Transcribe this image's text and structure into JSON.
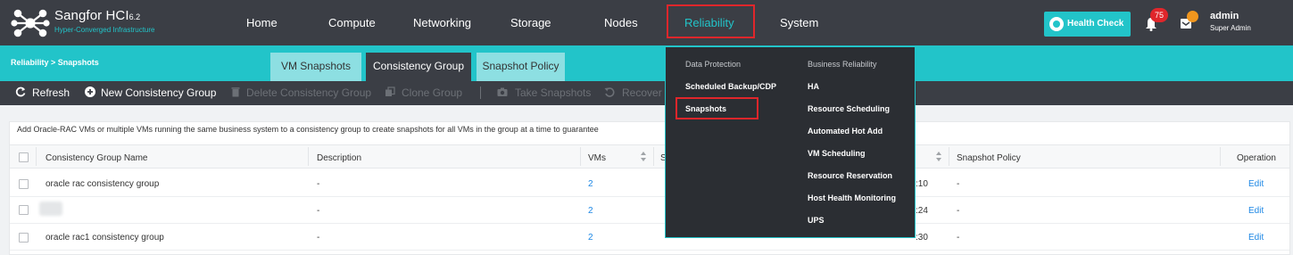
{
  "brand": {
    "name": "Sangfor HCI",
    "version": "6.2",
    "subtitle": "Hyper-Converged Infrastructure"
  },
  "nav": {
    "items": [
      "Home",
      "Compute",
      "Networking",
      "Storage",
      "Nodes",
      "Reliability",
      "System"
    ],
    "active": "Reliability"
  },
  "header": {
    "health_check": "Health Check",
    "alert_count": "75",
    "username": "admin",
    "role": "Super Admin"
  },
  "breadcrumb": "Reliability > Snapshots",
  "tabs": [
    "VM Snapshots",
    "Consistency Group",
    "Snapshot Policy"
  ],
  "active_tab": "Consistency Group",
  "toolbar": {
    "refresh": "Refresh",
    "new_group": "New Consistency Group",
    "delete_group": "Delete Consistency Group",
    "clone_group": "Clone Group",
    "take_snapshots": "Take Snapshots",
    "recover": "Recover"
  },
  "info_text": "Add Oracle-RAC VMs or multiple VMs running the same business system to a consistency group to create snapshots for all VMs in the group at a time to guarantee",
  "table": {
    "columns": [
      "Consistency Group Name",
      "Description",
      "VMs",
      "Snapshot Policy",
      "Operation"
    ],
    "rows": [
      {
        "name": "oracle rac consistency group",
        "description": "-",
        "vms": "2",
        "time_suffix": ":10",
        "policy": "-",
        "operation": "Edit"
      },
      {
        "name": "",
        "description": "-",
        "vms": "2",
        "time_suffix": ":24",
        "policy": "-",
        "operation": "Edit"
      },
      {
        "name": "oracle rac1 consistency group",
        "description": "-",
        "vms": "2",
        "time_suffix": ":30",
        "policy": "-",
        "operation": "Edit"
      }
    ]
  },
  "dropdown": {
    "left_heading": "Data Protection",
    "left_items": [
      "Scheduled Backup/CDP",
      "Snapshots"
    ],
    "right_heading": "Business Reliability",
    "right_items": [
      "HA",
      "Resource Scheduling",
      "Automated Hot Add",
      "VM Scheduling",
      "Resource Reservation",
      "Host Health Monitoring",
      "UPS"
    ]
  },
  "colors": {
    "topbar": "#3b3e45",
    "accent": "#22c4c9",
    "highlight": "#e0262b",
    "link": "#1e88e5"
  }
}
